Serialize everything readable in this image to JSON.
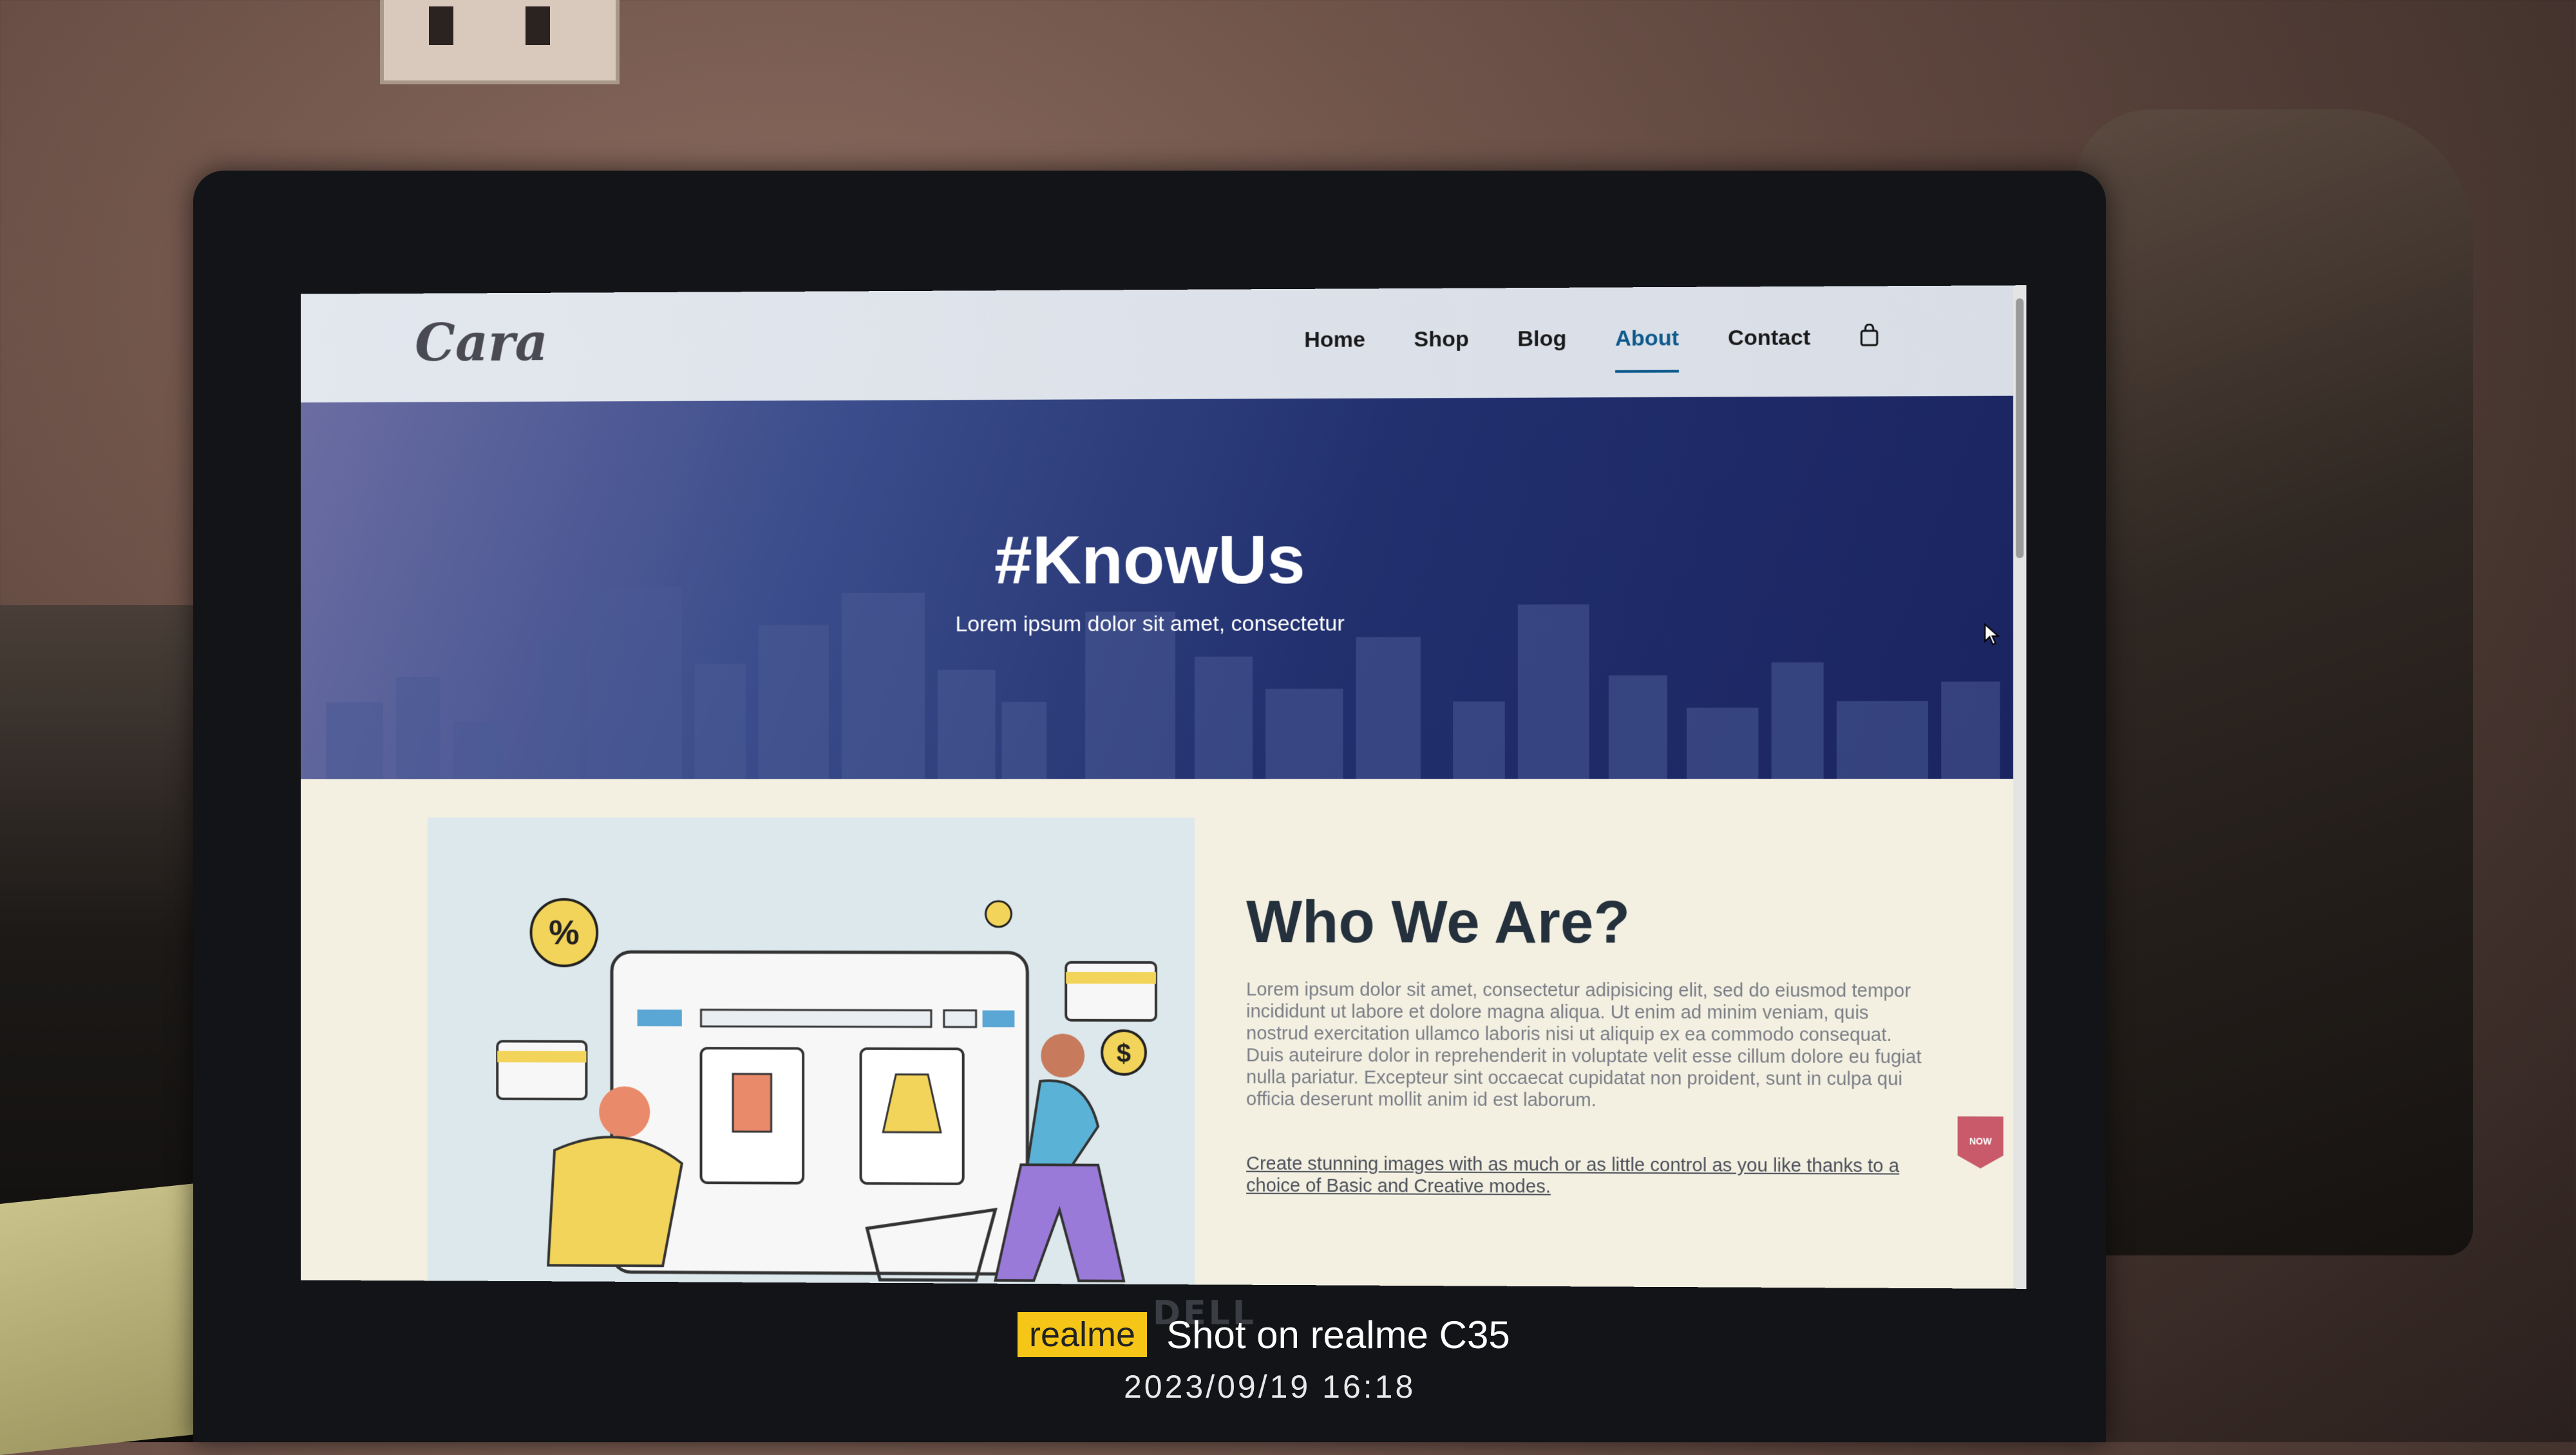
{
  "site": {
    "logo_text": "Cara",
    "nav": [
      {
        "label": "Home"
      },
      {
        "label": "Shop"
      },
      {
        "label": "Blog"
      },
      {
        "label": "About",
        "active": true
      },
      {
        "label": "Contact"
      }
    ],
    "cart_icon": "shopping-bag-icon"
  },
  "hero": {
    "title": "#KnowUs",
    "subtitle": "Lorem ipsum dolor sit amet, consectetur"
  },
  "about": {
    "title": "Who We Are?",
    "body": "Lorem ipsum dolor sit amet, consectetur adipisicing elit, sed do eiusmod tempor incididunt ut labore et dolore magna aliqua. Ut enim ad minim veniam, quis nostrud exercitation ullamco laboris nisi ut aliquip ex ea commodo consequat. Duis auteirure dolor in reprehenderit in voluptate velit esse cillum dolore eu fugiat nulla pariatur. Excepteur sint occaecat cupidatat non proident, sunt in culpa qui officia deserunt mollit anim id est laborum.",
    "link_text": "Create stunning images with as much or as little control as you like thanks to a choice of Basic and Creative modes.",
    "badge_text": "NOW"
  },
  "illustration": {
    "percent_symbol": "%",
    "dollar_symbol": "$"
  },
  "laptop_brand": "DELL",
  "camera": {
    "brand": "realme",
    "shot_text": "Shot on realme C35",
    "timestamp": "2023/09/19  16:18"
  },
  "colors": {
    "accent": "#0d5a8c",
    "hero_dark": "#1a2460",
    "title_text": "#24303c",
    "badge": "#c85a6a",
    "watermark_chip": "#f5c518"
  }
}
